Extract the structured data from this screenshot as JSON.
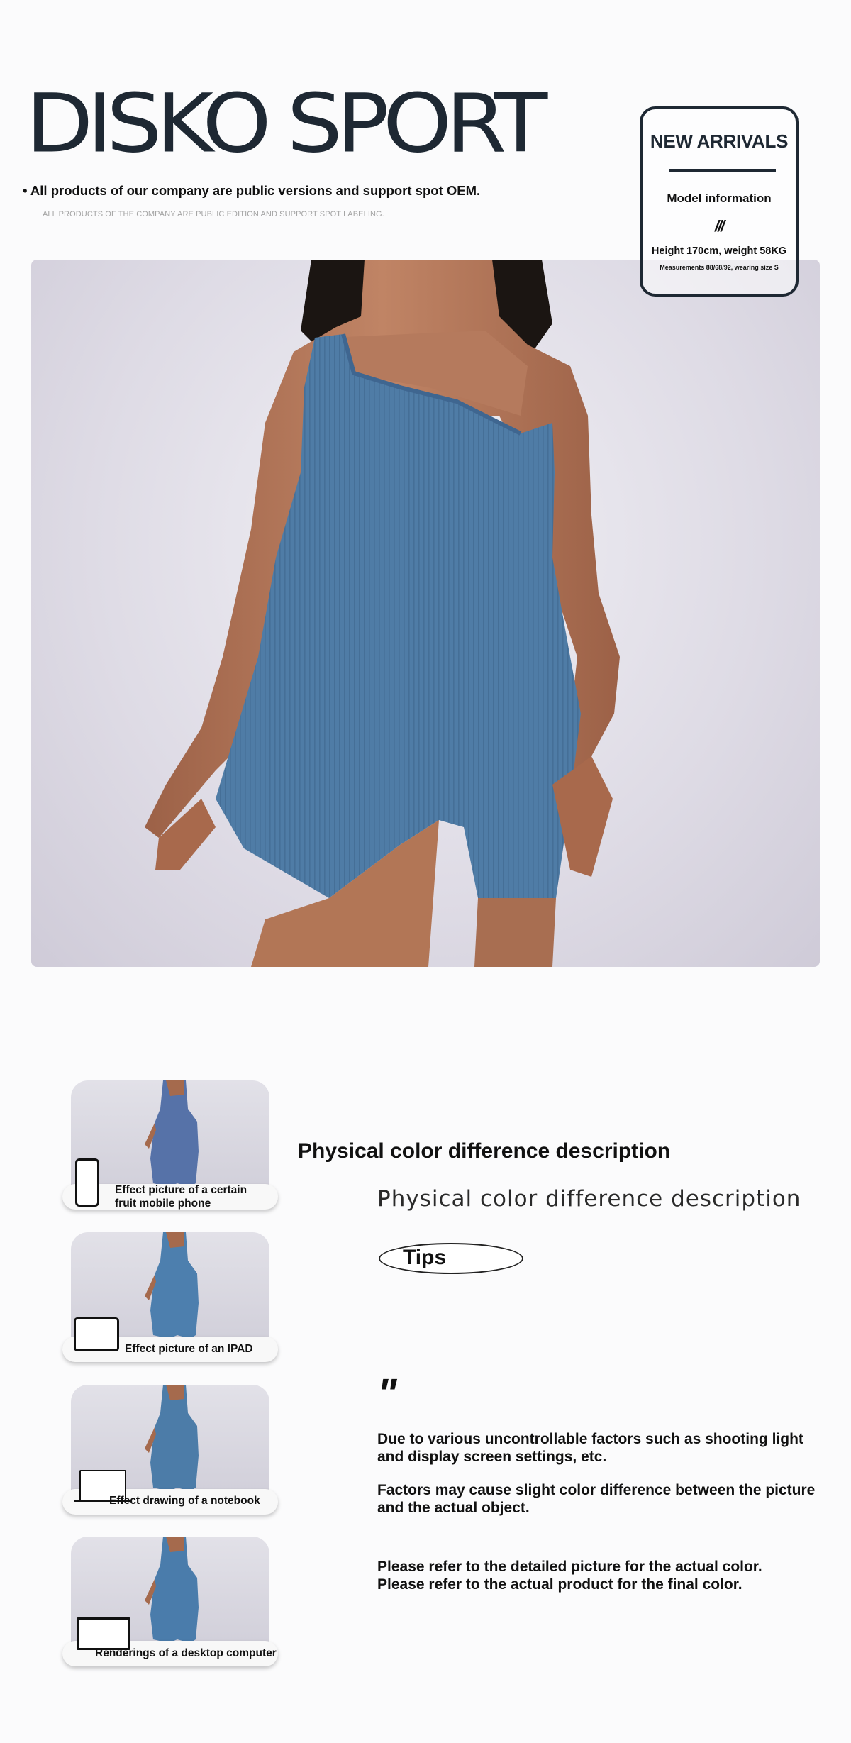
{
  "header": {
    "brand": "DISKO SPORT",
    "bullet": "• All products of our company are public versions and support spot OEM.",
    "sub_note": "ALL PRODUCTS OF THE COMPANY ARE PUBLIC EDITION AND SUPPORT SPOT LABELING."
  },
  "model_card": {
    "title": "NEW ARRIVALS",
    "label": "Model information",
    "mark": "///",
    "height_weight": "Height 170cm, weight 58KG",
    "measurements": "Measurements 88/68/92, wearing size S"
  },
  "effects": [
    {
      "caption_line1": "Effect picture of a certain",
      "caption_line2": "fruit mobile phone",
      "device_icon": "phone-icon"
    },
    {
      "caption_line1": "Effect picture of an IPAD",
      "caption_line2": "",
      "device_icon": "tablet-icon"
    },
    {
      "caption_line1": "Effect drawing of a notebook",
      "caption_line2": "",
      "device_icon": "notebook-icon"
    },
    {
      "caption_line1": "Renderings of a desktop computer",
      "caption_line2": "",
      "device_icon": "monitor-icon"
    }
  ],
  "color_section": {
    "title": "Physical color difference description",
    "subtitle": "Physical color difference description",
    "tips_label": "Tips",
    "quote_mark": "\"",
    "note1_line1": "Due to various uncontrollable factors such as shooting light",
    "note1_line2": "and display screen settings, etc.",
    "note2_line1": "Factors may cause slight color difference between the picture",
    "note2_line2": "and the actual object.",
    "note3_line1": "Please refer to the detailed picture for the actual color.",
    "note3_line2": "Please refer to the actual product for the final color."
  },
  "colors": {
    "brand_dark": "#1e2833",
    "garment_blue": "#4f7ca6",
    "skin": "#b5775a"
  }
}
